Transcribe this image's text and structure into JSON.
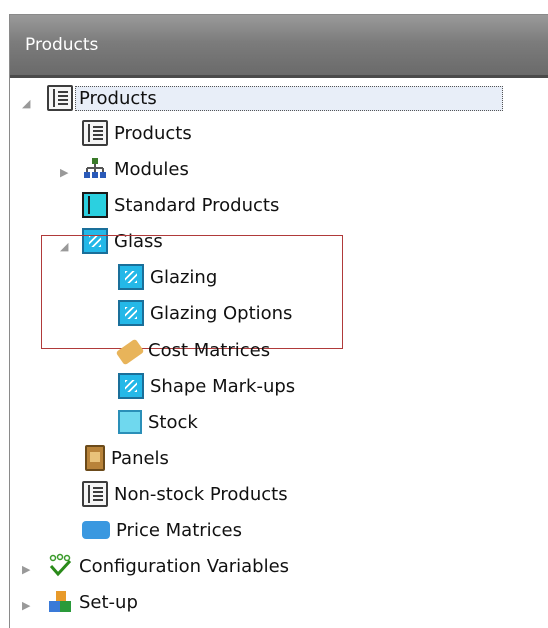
{
  "panel": {
    "title": "Products"
  },
  "tree": {
    "root": {
      "label": "Products"
    },
    "products": {
      "label": "Products"
    },
    "modules": {
      "label": "Modules"
    },
    "standard_products": {
      "label": "Standard Products"
    },
    "glass": {
      "label": "Glass"
    },
    "glazing": {
      "label": "Glazing"
    },
    "glazing_options": {
      "label": "Glazing Options"
    },
    "cost_matrices": {
      "label": "Cost Matrices"
    },
    "shape_markups": {
      "label": "Shape Mark-ups"
    },
    "stock": {
      "label": "Stock"
    },
    "panels": {
      "label": "Panels"
    },
    "non_stock_products": {
      "label": "Non-stock Products"
    },
    "price_matrices": {
      "label": "Price Matrices"
    },
    "configuration_variables": {
      "label": "Configuration Variables"
    },
    "setup": {
      "label": "Set-up"
    }
  },
  "icons": {
    "root": "book-icon",
    "products": "book-icon",
    "modules": "hierarchy-icon",
    "standard_products": "standard-product-icon",
    "glass": "glass-icon",
    "glazing": "glass-icon",
    "glazing_options": "glass-icon",
    "cost_matrices": "tag-icon",
    "shape_markups": "glass-icon",
    "stock": "glass-pane-icon",
    "panels": "panel-door-icon",
    "non_stock_products": "book-icon",
    "price_matrices": "price-matrix-icon",
    "configuration_variables": "variables-checkmark-icon",
    "setup": "setup-blocks-icon"
  },
  "colors": {
    "header": "#7c7c7c",
    "selection_background": "#e8eef8",
    "highlight_border": "#b03a3a",
    "glass_blue": "#24b8e8"
  }
}
